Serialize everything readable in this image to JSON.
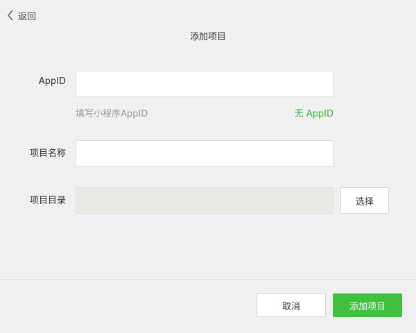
{
  "header": {
    "back_label": "返回",
    "title": "添加项目"
  },
  "form": {
    "appid": {
      "label": "AppID",
      "value": "",
      "hint": "填写小程序AppID",
      "no_appid_link": "无 AppID"
    },
    "project_name": {
      "label": "项目名称",
      "value": ""
    },
    "project_dir": {
      "label": "项目目录",
      "value": "",
      "choose_label": "选择"
    }
  },
  "footer": {
    "cancel_label": "取消",
    "submit_label": "添加项目"
  },
  "colors": {
    "accent": "#3fc13f",
    "link": "#3eb13e",
    "background": "#f0f0f0"
  },
  "icons": {
    "back": "chevron-left-icon"
  }
}
